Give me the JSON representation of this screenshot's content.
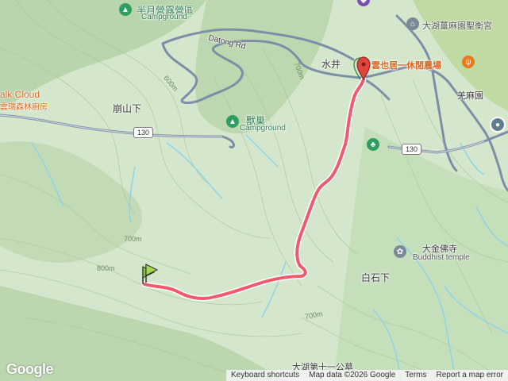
{
  "places": {
    "banyue_campground": {
      "name": "半月營露營區",
      "sub": "Campground"
    },
    "datong_rd": "Datong Rd",
    "shuijing": "水井",
    "yunyeju_farm": "雲也居一休閒農場",
    "dahu_mushroom_farm": "大湖薑麻園聖衡宮",
    "jiangmayuan": "羌麻園",
    "walk_cloud": "alk Cloud",
    "walk_cloud_sub": "雲瑞森林廚房",
    "bengshanxia": "崩山下",
    "shouchao_campground": {
      "name": "獸巢",
      "sub": "Campground"
    },
    "dajin_temple": {
      "name": "大金佛寺",
      "sub": "Buddhist temple"
    },
    "baishixia": "白石下",
    "dahu_cemetery": "大湖第十一公墓"
  },
  "roads": {
    "route_130_a": "130",
    "route_130_b": "130"
  },
  "elevations": {
    "e600": "600m",
    "e700a": "700m",
    "e700b": "700m",
    "e800": "800m",
    "e700c": "700m"
  },
  "icons": {
    "start_flag": "green-flag-icon",
    "end_marker": "red-map-pin-icon",
    "campground": "tent-triangle-icon",
    "restaurant": "fork-knife-icon",
    "temple": "temple-icon",
    "park": "tree-icon",
    "poi_circle": "poi-circle-icon"
  },
  "colors": {
    "track": "#f05a6e",
    "track_outline": "#ffffff",
    "road": "#7d8fa6",
    "water": "#8fd3ea",
    "terrain": "#cfe3c6"
  },
  "footer": {
    "logo": "Google",
    "keyboard": "Keyboard shortcuts",
    "mapdata": "Map data ©2026 Google",
    "terms": "Terms",
    "report": "Report a map error"
  }
}
